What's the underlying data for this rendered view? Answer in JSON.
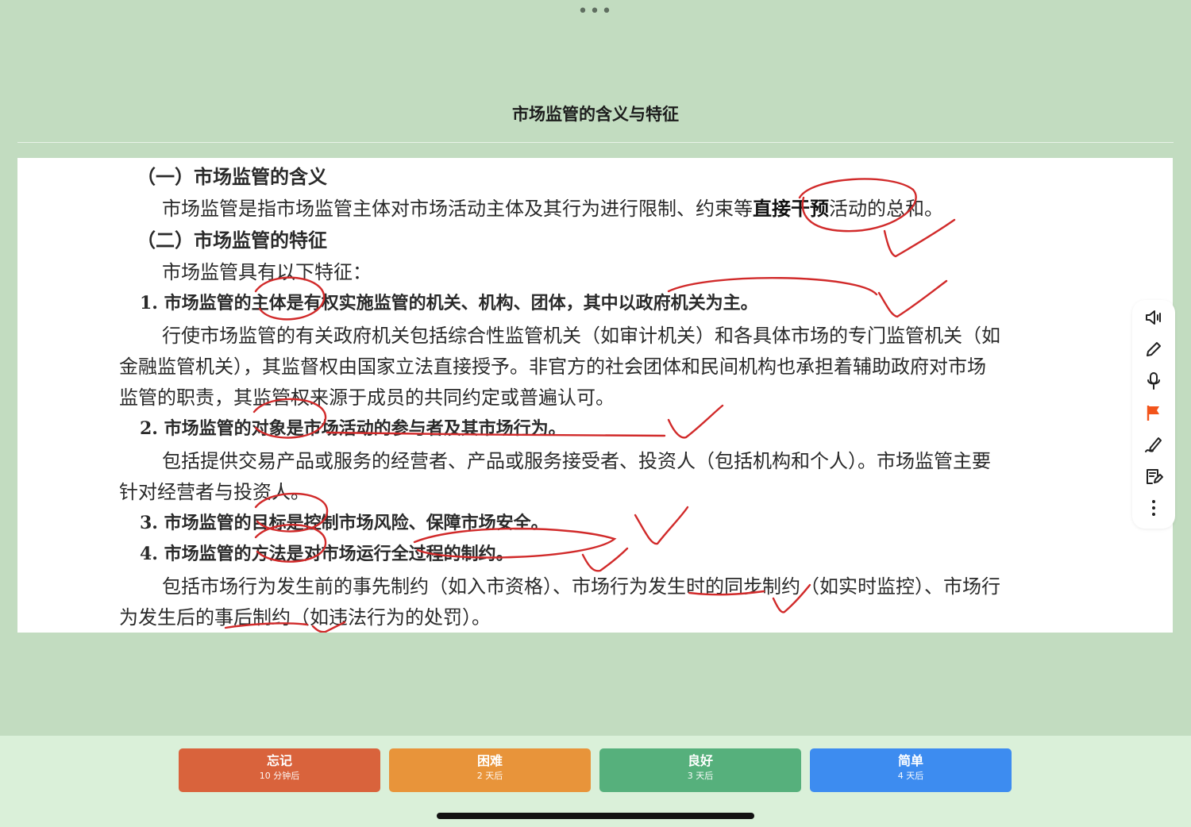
{
  "header": {
    "more_glyph": "•••",
    "title": "市场监管的含义与特征"
  },
  "doc": {
    "h1": "（一）市场监管的含义",
    "p1_a": "市场监管是指市场监管主体对市场活动主体及其行为进行限制、约束等",
    "p1_b": "直接干预",
    "p1_c": "活动的总和。",
    "h2": "（二）市场监管的特征",
    "p2": "市场监管具有以下特征：",
    "f1": "1. 市场监管的主体是有权实施监管的机关、机构、团体，其中以政府机关为主。",
    "f1_l1": "行使市场监管的有关政府机关包括综合性监管机关（如审计机关）和各具体市场的专门监管机关（如",
    "f1_l2": "金融监管机关），其监督权由国家立法直接授予。非官方的社会团体和民间机构也承担着辅助政府对市场",
    "f1_l3": "监管的职责，其监管权来源于成员的共同约定或普遍认可。",
    "f2": "2. 市场监管的对象是市场活动的参与者及其市场行为。",
    "f2_l1": "包括提供交易产品或服务的经营者、产品或服务接受者、投资人（包括机构和个人）。市场监管主要",
    "f2_l2": "针对经营者与投资人。",
    "f3": "3. 市场监管的目标是控制市场风险、保障市场安全。",
    "f4": "4. 市场监管的方法是对市场运行全过程的制约。",
    "f4_l1": "包括市场行为发生前的事先制约（如入市资格）、市场行为发生时的同步制约（如实时监控）、市场行",
    "f4_l2": "为发生后的事后制约（如违法行为的处罚）。"
  },
  "annotation_color": "#d12a2a",
  "toolbar": {
    "items": [
      "speaker-icon",
      "pencil-icon",
      "microphone-icon",
      "flag-icon",
      "handwriting-icon",
      "edit-note-icon",
      "more-vertical-icon"
    ],
    "flag_color": "#f2541b"
  },
  "ratings": [
    {
      "label": "忘记",
      "interval": "10 分钟后",
      "color": "#d9633c"
    },
    {
      "label": "困难",
      "interval": "2 天后",
      "color": "#e8943a"
    },
    {
      "label": "良好",
      "interval": "3 天后",
      "color": "#56b07c"
    },
    {
      "label": "简单",
      "interval": "4 天后",
      "color": "#3d8cf0"
    }
  ]
}
